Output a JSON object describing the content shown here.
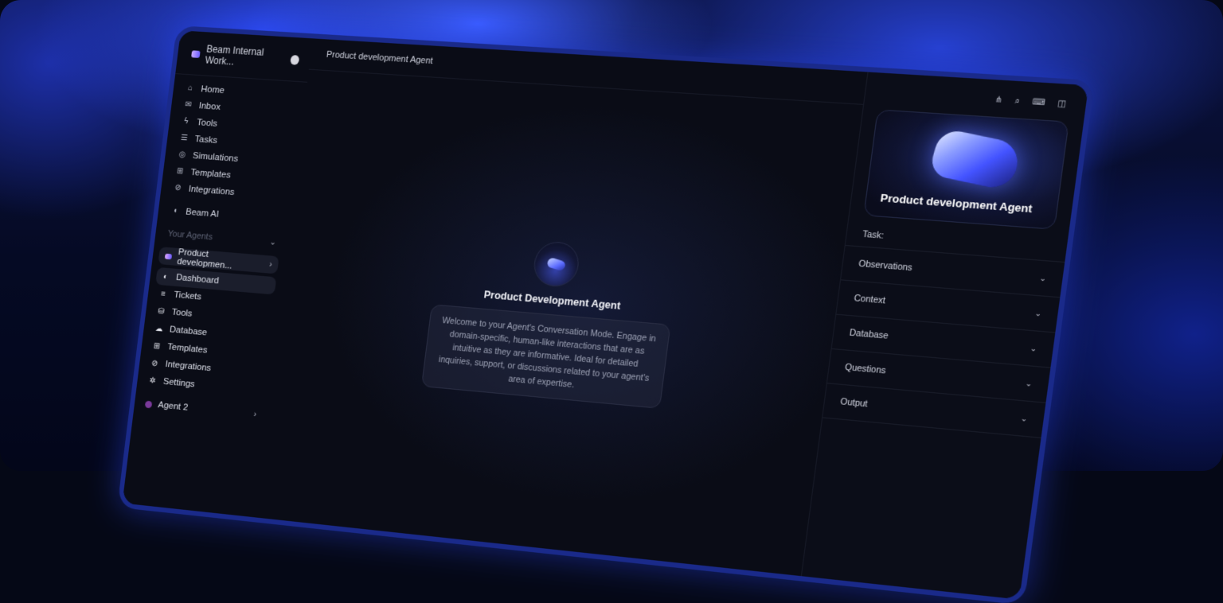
{
  "workspace": {
    "name": "Beam Internal Work..."
  },
  "nav": [
    {
      "label": "Home",
      "icon": "home-icon",
      "glyph": "⌂"
    },
    {
      "label": "Inbox",
      "icon": "inbox-icon",
      "glyph": "✉"
    },
    {
      "label": "Tools",
      "icon": "bolt-icon",
      "glyph": "ϟ"
    },
    {
      "label": "Tasks",
      "icon": "list-icon",
      "glyph": "☰"
    },
    {
      "label": "Simulations",
      "icon": "simulation-icon",
      "glyph": "◎"
    },
    {
      "label": "Templates",
      "icon": "grid-icon",
      "glyph": "⊞"
    },
    {
      "label": "Integrations",
      "icon": "link-icon",
      "glyph": "⊘"
    }
  ],
  "beam_ai": {
    "label": "Beam AI"
  },
  "your_agents": {
    "label": "Your Agents"
  },
  "agent1": {
    "label": "Product developmen..."
  },
  "agent_subnav": [
    {
      "label": "Dashboard",
      "icon": "dashboard-icon",
      "glyph": "◐"
    },
    {
      "label": "Tickets",
      "icon": "tickets-icon",
      "glyph": "≡"
    },
    {
      "label": "Tools",
      "icon": "tools-icon",
      "glyph": "⛁"
    },
    {
      "label": "Database",
      "icon": "database-icon",
      "glyph": "☁"
    },
    {
      "label": "Templates",
      "icon": "grid-icon",
      "glyph": "⊞"
    },
    {
      "label": "Integrations",
      "icon": "link-icon",
      "glyph": "⊘"
    },
    {
      "label": "Settings",
      "icon": "settings-icon",
      "glyph": "✲"
    }
  ],
  "agent2": {
    "label": "Agent 2"
  },
  "topbar": {
    "title": "Product development Agent"
  },
  "conversation": {
    "agent_name": "Product Development Agent",
    "welcome": "Welcome to your Agent's Conversation Mode. Engage in domain-specific, human-like interactions that are as intuitive as they are informative. Ideal for detailed inquiries, support, or discussions related to your agent's area of expertise."
  },
  "panel": {
    "hero_title": "Product development Agent",
    "task_label": "Task:",
    "sections": [
      "Observations",
      "Context",
      "Database",
      "Questions",
      "Output"
    ]
  }
}
